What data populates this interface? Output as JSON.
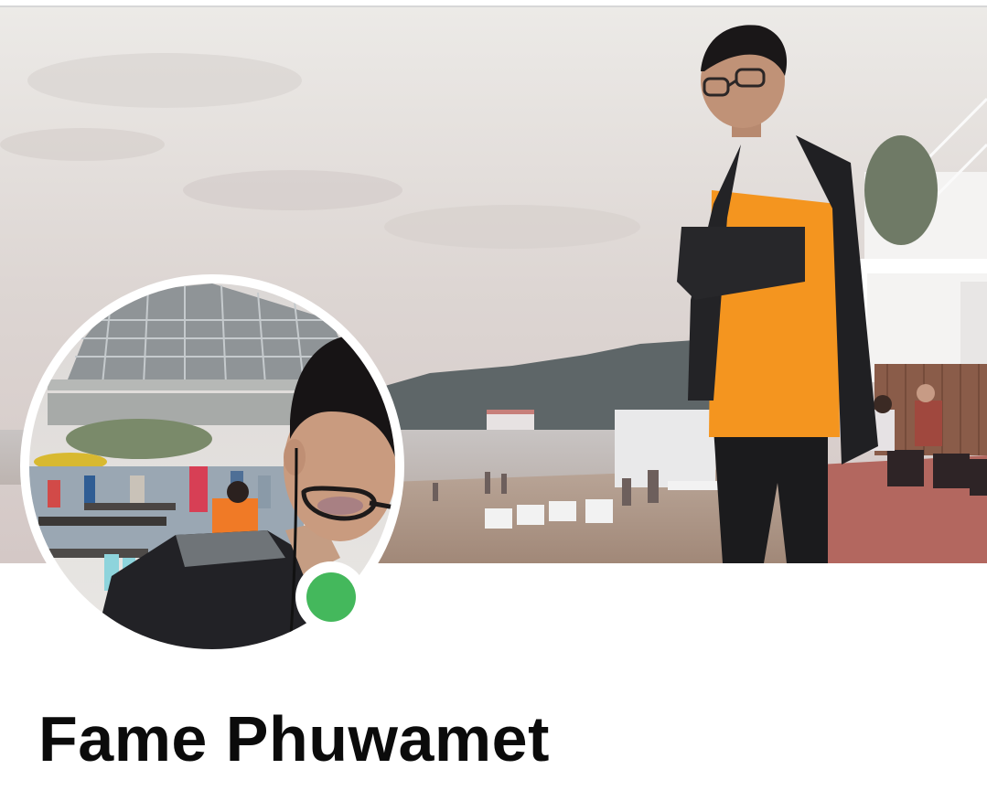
{
  "profile": {
    "name": "Fame Phuwamet",
    "online_status": "online",
    "status_color": "#44b85c"
  },
  "cover_photo": {
    "icon": "cover-photo"
  },
  "avatar": {
    "icon": "profile-picture"
  },
  "colors": {
    "background": "#ffffff",
    "name_text": "#0b0b0b"
  }
}
